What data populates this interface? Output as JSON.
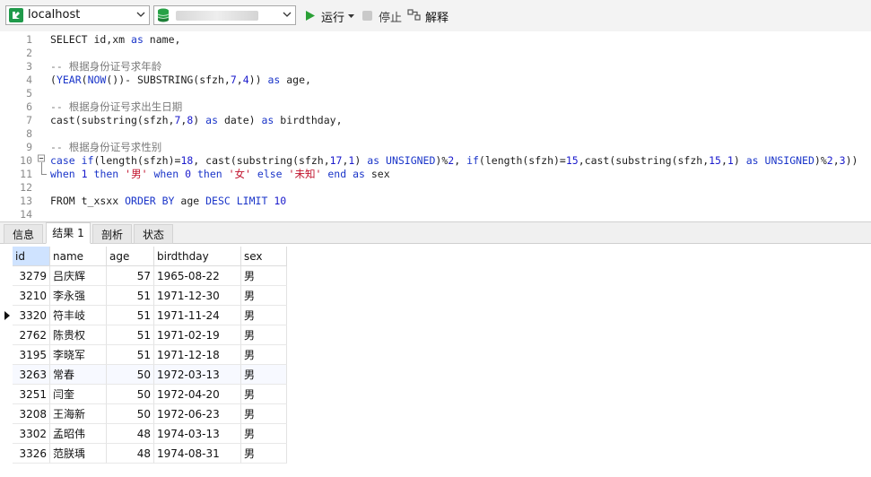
{
  "toolbar": {
    "connection": "localhost",
    "run_label": "运行",
    "stop_label": "停止",
    "explain_label": "解释"
  },
  "editor": {
    "lines": [
      {
        "n": "1",
        "tokens": [
          [
            "SELECT id,xm ",
            ""
          ],
          [
            "as",
            "kw"
          ],
          [
            " name,",
            ""
          ]
        ]
      },
      {
        "n": "2",
        "tokens": []
      },
      {
        "n": "3",
        "tokens": [
          [
            "-- 根据身份证号求年龄",
            "cmt"
          ]
        ]
      },
      {
        "n": "4",
        "tokens": [
          [
            "(",
            ""
          ],
          [
            "YEAR",
            "kw"
          ],
          [
            "(",
            ""
          ],
          [
            "NOW",
            "kw"
          ],
          [
            "())- SUBSTRING(sfzh,",
            ""
          ],
          [
            "7",
            "num"
          ],
          [
            ",",
            ""
          ],
          [
            "4",
            "num"
          ],
          [
            ")) ",
            ""
          ],
          [
            "as",
            "kw"
          ],
          [
            " age,",
            ""
          ]
        ]
      },
      {
        "n": "5",
        "tokens": []
      },
      {
        "n": "6",
        "tokens": [
          [
            "-- 根据身份证号求出生日期",
            "cmt"
          ]
        ]
      },
      {
        "n": "7",
        "tokens": [
          [
            "cast(substring(sfzh,",
            ""
          ],
          [
            "7",
            "num"
          ],
          [
            ",",
            ""
          ],
          [
            "8",
            "num"
          ],
          [
            ") ",
            ""
          ],
          [
            "as",
            "kw"
          ],
          [
            " date) ",
            ""
          ],
          [
            "as",
            "kw"
          ],
          [
            " birdthday,",
            ""
          ]
        ]
      },
      {
        "n": "8",
        "tokens": []
      },
      {
        "n": "9",
        "tokens": [
          [
            "-- 根据身份证号求性别",
            "cmt"
          ]
        ]
      },
      {
        "n": "10",
        "tokens": [
          [
            "case",
            "kw"
          ],
          [
            " ",
            ""
          ],
          [
            "if",
            "kw"
          ],
          [
            "(length(sfzh)=",
            ""
          ],
          [
            "18",
            "num"
          ],
          [
            ", cast(substring(sfzh,",
            ""
          ],
          [
            "17",
            "num"
          ],
          [
            ",",
            ""
          ],
          [
            "1",
            "num"
          ],
          [
            ") ",
            ""
          ],
          [
            "as",
            "kw"
          ],
          [
            " ",
            ""
          ],
          [
            "UNSIGNED",
            "kw"
          ],
          [
            ")%",
            ""
          ],
          [
            "2",
            "num"
          ],
          [
            ", ",
            ""
          ],
          [
            "if",
            "kw"
          ],
          [
            "(length(sfzh)=",
            ""
          ],
          [
            "15",
            "num"
          ],
          [
            ",cast(substring(sfzh,",
            ""
          ],
          [
            "15",
            "num"
          ],
          [
            ",",
            ""
          ],
          [
            "1",
            "num"
          ],
          [
            ") ",
            ""
          ],
          [
            "as",
            "kw"
          ],
          [
            " ",
            ""
          ],
          [
            "UNSIGNED",
            "kw"
          ],
          [
            ")%",
            ""
          ],
          [
            "2",
            "num"
          ],
          [
            ",",
            ""
          ],
          [
            "3",
            "num"
          ],
          [
            "))",
            ""
          ]
        ]
      },
      {
        "n": "11",
        "tokens": [
          [
            "when",
            "kw"
          ],
          [
            " ",
            ""
          ],
          [
            "1",
            "num"
          ],
          [
            " ",
            ""
          ],
          [
            "then",
            "kw"
          ],
          [
            " ",
            ""
          ],
          [
            "'男'",
            "str"
          ],
          [
            " ",
            ""
          ],
          [
            "when",
            "kw"
          ],
          [
            " ",
            ""
          ],
          [
            "0",
            "num"
          ],
          [
            " ",
            ""
          ],
          [
            "then",
            "kw"
          ],
          [
            " ",
            ""
          ],
          [
            "'女'",
            "str"
          ],
          [
            " ",
            ""
          ],
          [
            "else",
            "kw"
          ],
          [
            " ",
            ""
          ],
          [
            "'未知'",
            "str"
          ],
          [
            " ",
            ""
          ],
          [
            "end",
            "kw"
          ],
          [
            " ",
            ""
          ],
          [
            "as",
            "kw"
          ],
          [
            " sex",
            ""
          ]
        ]
      },
      {
        "n": "12",
        "tokens": []
      },
      {
        "n": "13",
        "tokens": [
          [
            "FROM t_xsxx ",
            ""
          ],
          [
            "ORDER BY",
            "kw"
          ],
          [
            " age ",
            ""
          ],
          [
            "DESC",
            "kw"
          ],
          [
            " ",
            ""
          ],
          [
            "LIMIT",
            "kw"
          ],
          [
            " ",
            ""
          ],
          [
            "10",
            "num"
          ]
        ]
      },
      {
        "n": "14",
        "tokens": []
      }
    ]
  },
  "tabs": [
    "信息",
    "结果 1",
    "剖析",
    "状态"
  ],
  "results": {
    "columns": [
      "id",
      "name",
      "age",
      "birdthday",
      "sex"
    ],
    "rows": [
      [
        "3279",
        "吕庆辉",
        "57",
        "1965-08-22",
        "男"
      ],
      [
        "3210",
        "李永强",
        "51",
        "1971-12-30",
        "男"
      ],
      [
        "3320",
        "符丰岐",
        "51",
        "1971-11-24",
        "男"
      ],
      [
        "2762",
        "陈贵权",
        "51",
        "1971-02-19",
        "男"
      ],
      [
        "3195",
        "李晓军",
        "51",
        "1971-12-18",
        "男"
      ],
      [
        "3263",
        "常春",
        "50",
        "1972-03-13",
        "男"
      ],
      [
        "3251",
        "闫奎",
        "50",
        "1972-04-20",
        "男"
      ],
      [
        "3208",
        "王海新",
        "50",
        "1972-06-23",
        "男"
      ],
      [
        "3302",
        "孟昭伟",
        "48",
        "1974-03-13",
        "男"
      ],
      [
        "3326",
        "范朕瑀",
        "48",
        "1974-08-31",
        "男"
      ]
    ]
  }
}
